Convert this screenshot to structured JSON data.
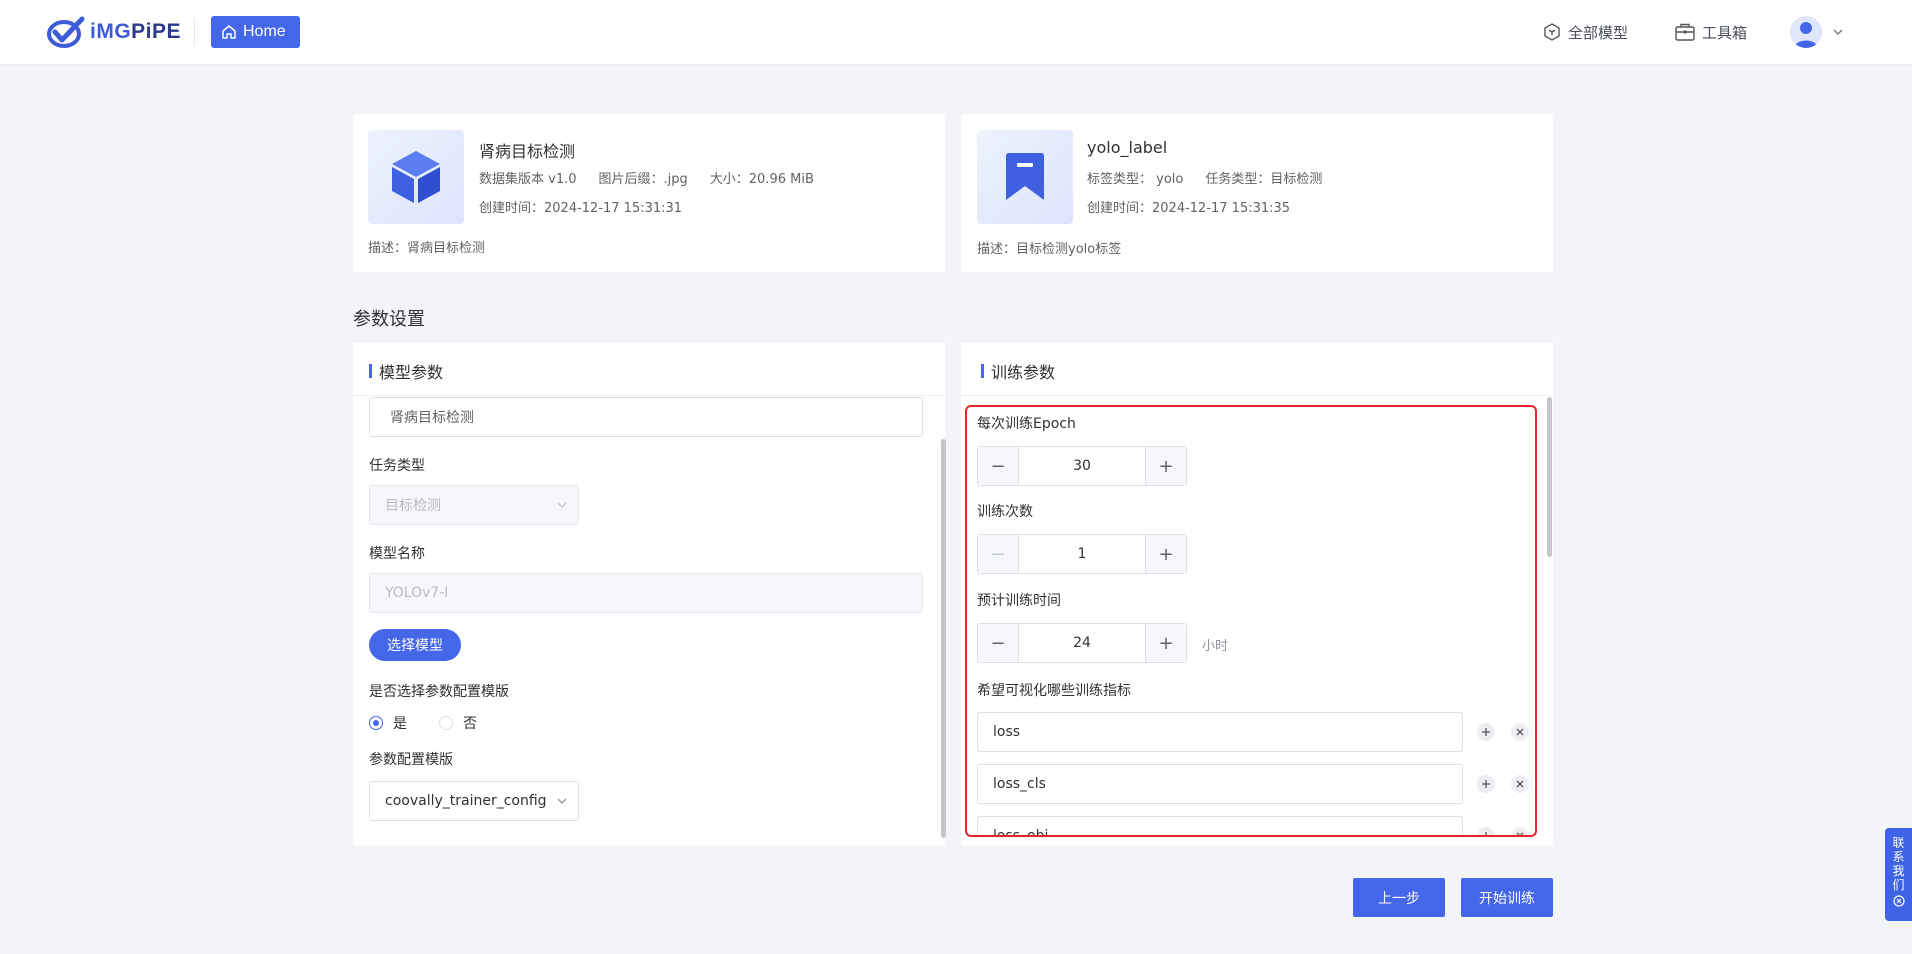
{
  "header": {
    "logo_text_prefix": "iMG",
    "logo_text_suffix": "PiPE",
    "home_label": "Home",
    "nav_models": "全部模型",
    "nav_toolbox": "工具箱"
  },
  "dataset_card": {
    "title": "肾病目标检测",
    "version": "数据集版本 v1.0",
    "suffix": "图片后缀：.jpg",
    "size": "大小：20.96 MiB",
    "created": "创建时间：2024-12-17 15:31:31",
    "desc": "描述：肾病目标检测"
  },
  "label_card": {
    "title": "yolo_label",
    "label_type": "标签类型：  yolo",
    "task_type": "任务类型：目标检测",
    "created": "创建时间：2024-12-17 15:31:35",
    "desc": "描述：目标检测yolo标签"
  },
  "section_title": "参数设置",
  "model_params": {
    "heading": "模型参数",
    "name_value": "肾病目标检测",
    "task_label": "任务类型",
    "task_value": "目标检测",
    "model_name_label": "模型名称",
    "model_name_value": "YOLOv7-l",
    "select_model_btn": "选择模型",
    "use_template_label": "是否选择参数配置模版",
    "radio_yes": "是",
    "radio_no": "否",
    "template_label": "参数配置模版",
    "template_value": "coovally_trainer_config"
  },
  "train_params": {
    "heading": "训练参数",
    "epoch_label": "每次训练Epoch",
    "epoch_value": "30",
    "times_label": "训练次数",
    "times_value": "1",
    "time_label": "预计训练时间",
    "time_value": "24",
    "time_unit": "小时",
    "metrics_label": "希望可视化哪些训练指标",
    "metrics": [
      "loss",
      "loss_cls",
      "loss_obj"
    ]
  },
  "footer": {
    "prev_label": "上一步",
    "start_label": "开始训练"
  },
  "contact": [
    "联",
    "系",
    "我",
    "们"
  ],
  "colors": {
    "primary": "#4466e8",
    "highlight": "#e5242b"
  }
}
